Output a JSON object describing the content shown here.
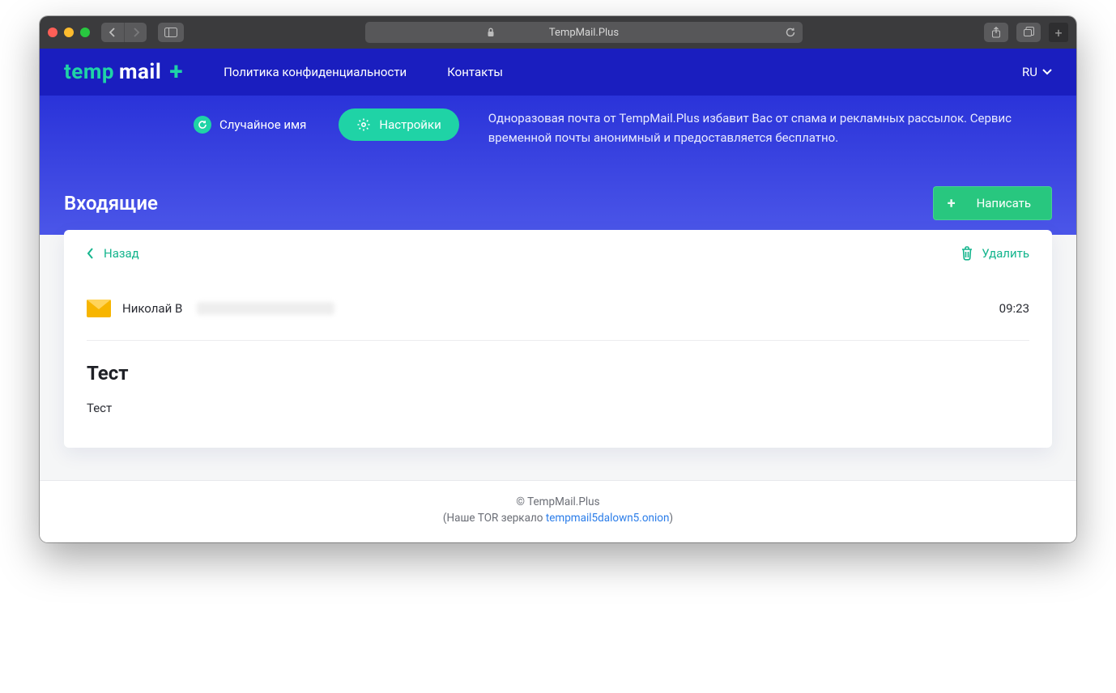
{
  "browser": {
    "address": "TempMail.Plus"
  },
  "header": {
    "nav_privacy": "Политика конфиденциальности",
    "nav_contacts": "Контакты",
    "lang": "RU"
  },
  "sub": {
    "random_label": "Случайное имя",
    "settings_label": "Настройки",
    "tagline": "Одноразовая почта от TempMail.Plus избавит Вас от спама и рекламных рассылок. Сервис временной почты анонимный и предоставляется бесплатно."
  },
  "inbox": {
    "title": "Входящие",
    "compose_label": "Написать"
  },
  "card": {
    "back_label": "Назад",
    "delete_label": "Удалить",
    "sender_name": "Николай В",
    "time": "09:23",
    "subject": "Тест",
    "body": "Тест"
  },
  "footer": {
    "copyright": "© TempMail.Plus",
    "tor_prefix": "(Наше TOR зеркало ",
    "tor_link": "tempmail5dalown5.onion",
    "tor_suffix": ")"
  }
}
